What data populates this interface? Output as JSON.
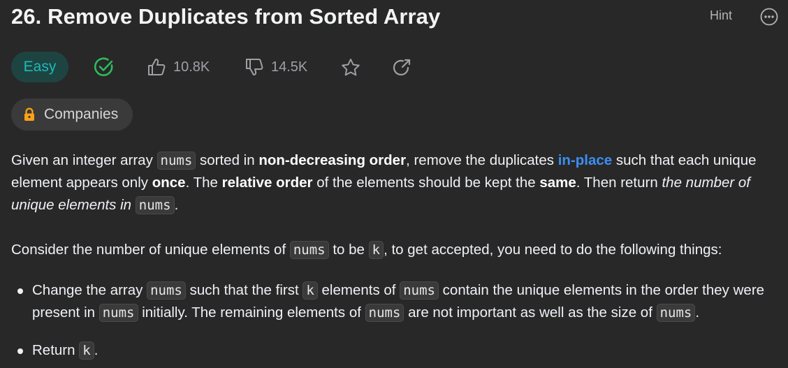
{
  "header": {
    "title": "26. Remove Duplicates from Sorted Array",
    "hint_label": "Hint",
    "more_icon": "ellipsis-circle-icon"
  },
  "meta": {
    "difficulty": "Easy",
    "difficulty_color": "#1cbaba",
    "solved_icon": "check-circle-icon",
    "solved_color": "#2cbb5d",
    "likes": "10.8K",
    "dislikes": "14.5K",
    "star_icon": "star-icon",
    "share_icon": "share-icon"
  },
  "companies": {
    "label": "Companies",
    "lock_color": "#ffa116"
  },
  "description": {
    "p1": [
      "Given an integer array ",
      "nums",
      " sorted in ",
      "non-decreasing order",
      ", remove the duplicates ",
      "in-place",
      " such that each unique element appears only ",
      "once",
      ". The ",
      "relative order",
      " of the elements should be kept the ",
      "same",
      ". Then return ",
      "the number of unique elements in ",
      "nums",
      "."
    ],
    "p2": [
      "Consider the number of unique elements of ",
      "nums",
      " to be ",
      "k",
      ", to get accepted, you need to do the following things:"
    ],
    "bullet1": [
      "Change the array ",
      "nums",
      " such that the first ",
      "k",
      " elements of ",
      "nums",
      " contain the unique elements in the order they were present in ",
      "nums",
      " initially. The remaining elements of ",
      "nums",
      " are not important as well as the size of ",
      "nums",
      "."
    ],
    "bullet2": [
      "Return ",
      "k",
      "."
    ]
  }
}
